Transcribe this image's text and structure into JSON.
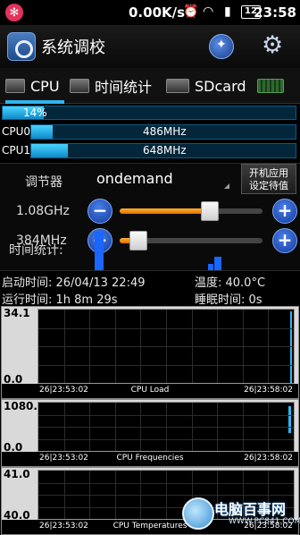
{
  "status_bar": {
    "net_speed": "0.00K/s",
    "battery": "12",
    "time": "23:58"
  },
  "app": {
    "title": "系统调校"
  },
  "tabs": [
    {
      "label": "CPU",
      "active": true
    },
    {
      "label": "时间统计",
      "active": false
    },
    {
      "label": "SDcard",
      "active": false
    }
  ],
  "usage": {
    "total": {
      "text": "14%",
      "fraction": 0.14
    },
    "cpu0": {
      "label": "CPU0",
      "text": "486MHz",
      "fraction": 0.08
    },
    "cpu1": {
      "label": "CPU1",
      "text": "648MHz",
      "fraction": 0.14
    }
  },
  "governor": {
    "label": "调节器",
    "value": "ondemand",
    "boot_button": "开机应用\n设定待值",
    "max_freq": {
      "label": "1.08GHz",
      "fraction": 0.63
    },
    "min_freq": {
      "label": "384MHz",
      "fraction": 0.13
    },
    "minus": "−",
    "plus": "+",
    "time_label": "时间统计:"
  },
  "info": {
    "boot_time": "启动时间: 26/04/13 22:49",
    "temperature": "温度:       40.0°C",
    "run_time": "运行时间: 1h 8m 29s",
    "sleep_time": "睡眠时间: 0s"
  },
  "graphs": [
    {
      "name": "cpu-load",
      "y_max": "34.1",
      "y_min": "0.0",
      "start": "26|23:53:02",
      "end": "26|23:58:02",
      "title": "CPU Load"
    },
    {
      "name": "cpu-frequencies",
      "y_max": "1080.0",
      "y_min": "0.0",
      "start": "26|23:53:02",
      "end": "26|23:58:02",
      "title": "CPU Frequencies"
    },
    {
      "name": "cpu-temperatures",
      "y_max": "41.0",
      "y_min": "40.0",
      "start": "26|23:53:02",
      "end": "26|23:58:02",
      "title": "CPU Temperatures"
    }
  ],
  "watermark": {
    "text": "电脑百事网",
    "sub": "WWW.PC841.COM"
  },
  "colors": {
    "accent": "#2cb6f0",
    "slider": "#f08a10",
    "button": "#1f56c8"
  }
}
